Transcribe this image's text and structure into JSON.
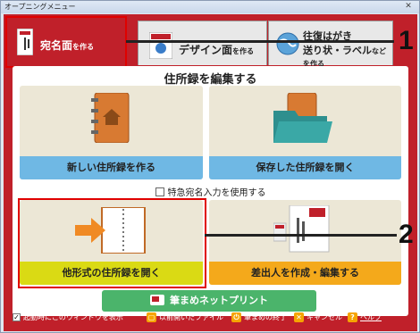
{
  "window": {
    "title": "オープニングメニュー",
    "close": "✕"
  },
  "tabs": [
    {
      "main": "宛名面",
      "small": "を作る"
    },
    {
      "main": "デザイン面",
      "small": "を作る"
    },
    {
      "main_line1": "往復はがき",
      "main_line2": "送り状・ラベル",
      "small": "などを作る"
    }
  ],
  "callouts": {
    "one": "1",
    "two": "2"
  },
  "section": {
    "title": "住所録を編集する"
  },
  "cards": {
    "new_book": "新しい住所録を作る",
    "open_saved": "保存した住所録を開く",
    "open_other": "他形式の住所録を開く",
    "sender": "差出人を作成・編集する"
  },
  "special_input": {
    "label": "特急宛名入力を使用する",
    "checked": false
  },
  "net_print": {
    "label": "筆まめネットプリント"
  },
  "footer": {
    "show_on_start": "起動時にこのウィンドウを表示",
    "show_on_start_checked": true,
    "prev_file": "以前開いたファイル",
    "quit": "筆まめの終了",
    "cancel": "キャンセル",
    "help": "ヘルプ"
  }
}
